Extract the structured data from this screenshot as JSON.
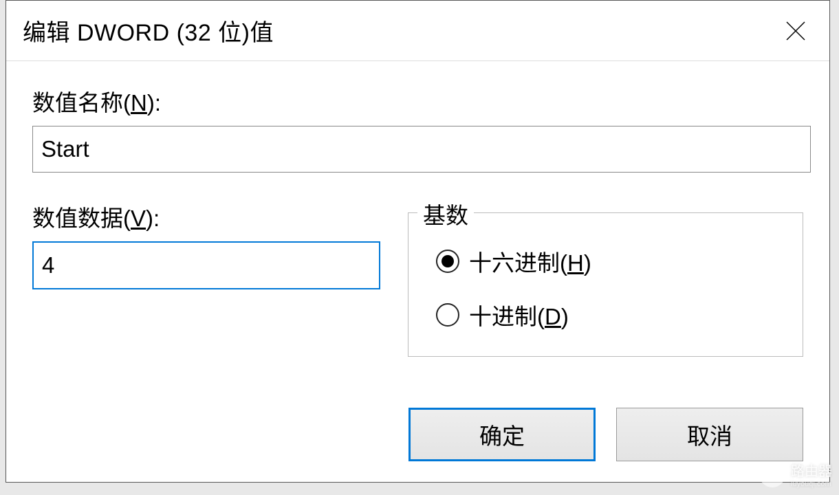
{
  "dialog": {
    "title": "编辑 DWORD (32 位)值",
    "name_label_pre": "数值名称(",
    "name_label_key": "N",
    "name_label_post": "):",
    "name_value": "Start",
    "value_label_pre": "数值数据(",
    "value_label_key": "V",
    "value_label_post": "):",
    "value_data": "4",
    "base_legend": "基数",
    "radios": {
      "hex_pre": "十六进制(",
      "hex_key": "H",
      "hex_post": ")",
      "hex_checked": true,
      "dec_pre": "十进制(",
      "dec_key": "D",
      "dec_post": ")",
      "dec_checked": false
    },
    "ok_label": "确定",
    "cancel_label": "取消"
  },
  "watermark": {
    "text": "路由器",
    "sub": "luyouqi.com"
  }
}
